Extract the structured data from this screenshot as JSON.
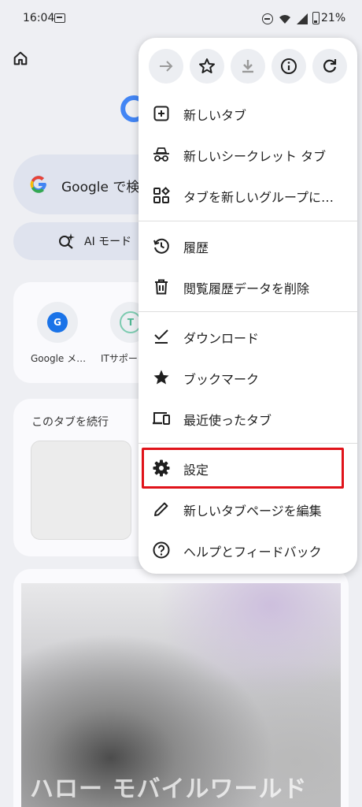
{
  "status_bar": {
    "time": "16:04",
    "battery": "21%"
  },
  "background": {
    "search_placeholder": "Google で検",
    "ai_mode_label": "AI モード",
    "shortcuts": [
      {
        "label": "Google メ…",
        "icon_letter": "G"
      },
      {
        "label": "ITサポー",
        "icon_letter": "T"
      }
    ],
    "continue_tab_title": "このタブを続行",
    "watermark": "ハロー モバイルワールド"
  },
  "menu": {
    "top_buttons": [
      {
        "name": "forward-icon",
        "disabled": true
      },
      {
        "name": "bookmark-star-icon",
        "disabled": false
      },
      {
        "name": "download-icon",
        "disabled": true
      },
      {
        "name": "info-icon",
        "disabled": false
      },
      {
        "name": "refresh-icon",
        "disabled": false
      }
    ],
    "items": [
      {
        "label": "新しいタブ",
        "icon": "new-tab-icon"
      },
      {
        "label": "新しいシークレット タブ",
        "icon": "incognito-icon"
      },
      {
        "label": "タブを新しいグループに…",
        "icon": "tab-group-icon"
      },
      {
        "label": "履歴",
        "icon": "history-icon"
      },
      {
        "label": "閲覧履歴データを削除",
        "icon": "trash-icon"
      },
      {
        "label": "ダウンロード",
        "icon": "download-check-icon"
      },
      {
        "label": "ブックマーク",
        "icon": "star-icon"
      },
      {
        "label": "最近使ったタブ",
        "icon": "devices-icon"
      },
      {
        "label": "設定",
        "icon": "gear-icon"
      },
      {
        "label": "新しいタブページを編集",
        "icon": "pencil-icon"
      },
      {
        "label": "ヘルプとフィードバック",
        "icon": "help-icon"
      }
    ],
    "highlighted_item": "設定"
  },
  "colors": {
    "highlight": "#e0131a",
    "menu_bg": "#ffffff",
    "page_bg": "#eeeff3"
  }
}
